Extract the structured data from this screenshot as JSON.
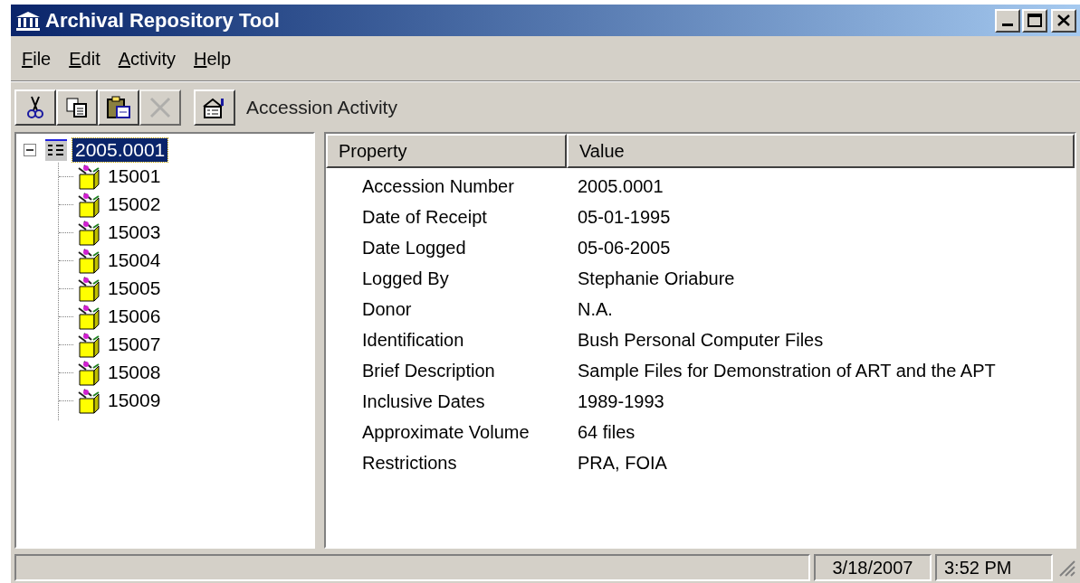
{
  "window": {
    "title": "Archival Repository Tool"
  },
  "menu": [
    "File",
    "Edit",
    "Activity",
    "Help"
  ],
  "toolbar": {
    "buttons": [
      {
        "kind": "cut",
        "disabled": false
      },
      {
        "kind": "copy",
        "disabled": false
      },
      {
        "kind": "paste",
        "disabled": false
      },
      {
        "kind": "delete",
        "disabled": true
      },
      {
        "kind": "properties",
        "disabled": false
      }
    ],
    "label": "Accession Activity"
  },
  "tree": {
    "root": {
      "label": "2005.0001",
      "expanded": true,
      "selected": true,
      "children": [
        {
          "label": "15001",
          "selected": false
        },
        {
          "label": "15002",
          "selected": false
        },
        {
          "label": "15003",
          "selected": false
        },
        {
          "label": "15004",
          "selected": false
        },
        {
          "label": "15005",
          "selected": false
        },
        {
          "label": "15006",
          "selected": false
        },
        {
          "label": "15007",
          "selected": false
        },
        {
          "label": "15008",
          "selected": false
        },
        {
          "label": "15009",
          "selected": false
        }
      ]
    }
  },
  "table": {
    "columns": [
      "Property",
      "Value"
    ],
    "rows": [
      [
        "Accession Number",
        "2005.0001"
      ],
      [
        "Date of Receipt",
        "05-01-1995"
      ],
      [
        "Date Logged",
        "05-06-2005"
      ],
      [
        "Logged By",
        "Stephanie Oriabure"
      ],
      [
        "Donor",
        "N.A."
      ],
      [
        "Identification",
        "Bush Personal Computer Files"
      ],
      [
        "Brief Description",
        "Sample Files for Demonstration of ART and the APT"
      ],
      [
        "Inclusive Dates",
        "1989-1993"
      ],
      [
        "Approximate Volume",
        "64 files"
      ],
      [
        "Restrictions",
        "PRA, FOIA"
      ]
    ]
  },
  "status_bar": {
    "date": "3/18/2007",
    "time": "3:52 PM"
  }
}
